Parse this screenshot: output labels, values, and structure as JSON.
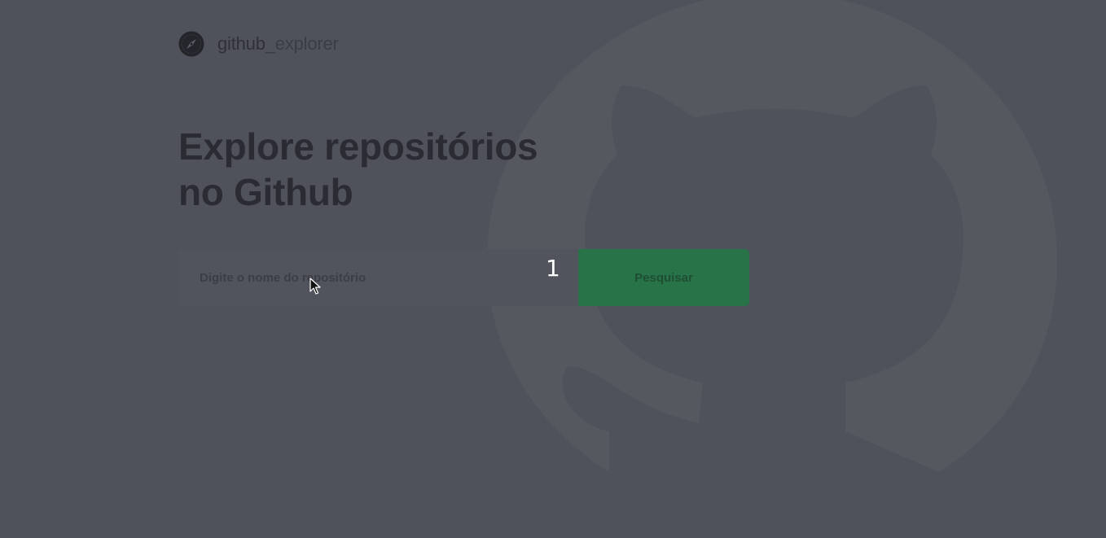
{
  "header": {
    "logo_icon": "compass-icon",
    "brand_main": "github",
    "brand_suffix": "_explorer"
  },
  "hero": {
    "title_line1": "Explore repositórios",
    "title_line2": "no Github"
  },
  "search": {
    "placeholder": "Digite o nome do repositório",
    "value": "",
    "button_label": "Pesquisar"
  },
  "overlay": {
    "step_number": "1",
    "cursor_icon": "mouse-pointer-icon"
  },
  "background": {
    "watermark_icon": "github-octocat-icon"
  },
  "colors": {
    "page_background": "#4f525b",
    "accent_button": "#287348",
    "title_text": "#2b2c33"
  }
}
